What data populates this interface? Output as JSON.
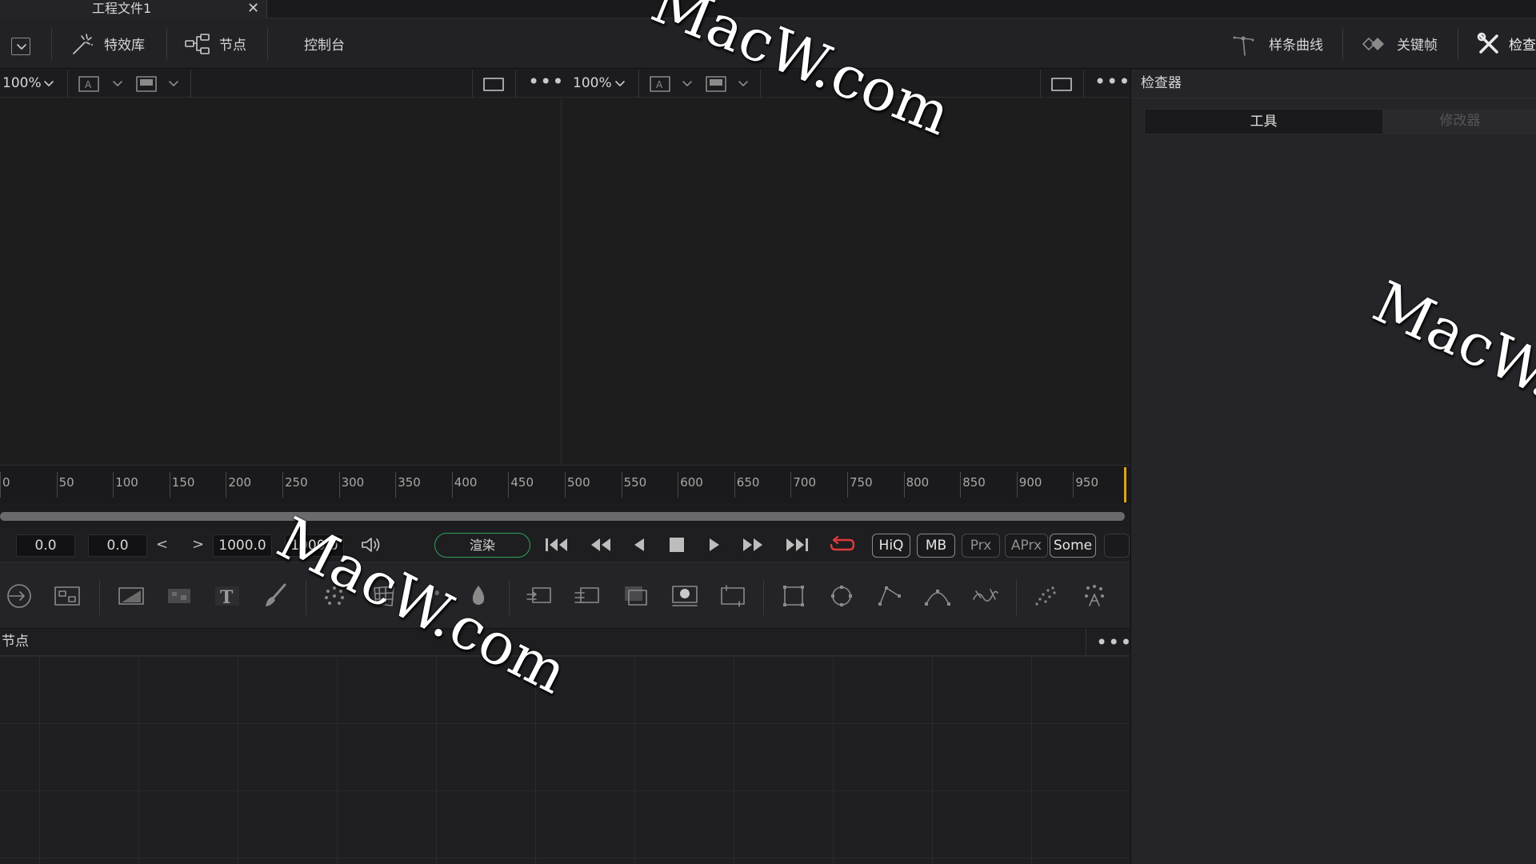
{
  "tab": {
    "title": "工程文件1",
    "close": "✕"
  },
  "toolbar": {
    "effects_library": "特效库",
    "nodes": "节点",
    "console": "控制台",
    "spline": "样条曲线",
    "keyframes": "关键帧",
    "inspector": "检查"
  },
  "viewers": {
    "left": {
      "zoom": "100%"
    },
    "right": {
      "zoom": "100%"
    }
  },
  "inspector": {
    "title": "检查器",
    "tab_tools": "工具",
    "tab_modifiers": "修改器"
  },
  "ruler": {
    "labels": [
      "0",
      "50",
      "100",
      "150",
      "200",
      "250",
      "300",
      "350",
      "400",
      "450",
      "500",
      "550",
      "600",
      "650",
      "700",
      "750",
      "800",
      "850",
      "900",
      "950"
    ]
  },
  "transport": {
    "global_start": "0.0",
    "render_start": "0.0",
    "render_end": "1000.0",
    "global_end": "1000.0",
    "render_button": "渲染",
    "hiq": "HiQ",
    "mb": "MB",
    "prx": "Prx",
    "aprx": "APrx",
    "some": "Some",
    "prev_arrow": "<",
    "next_arrow": ">"
  },
  "nodes_panel": {
    "title": "节点"
  },
  "more": "•••",
  "watermark": "MacW.com",
  "colors": {
    "render_border": "#2aa35a",
    "playhead": "#e0a31a",
    "loop_icon": "#e03a3a"
  }
}
